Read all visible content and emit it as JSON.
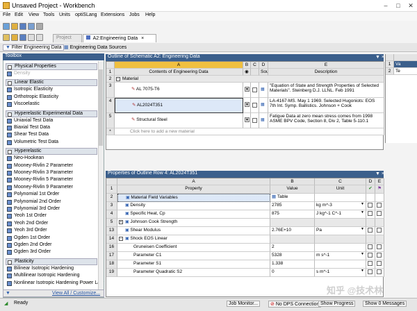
{
  "window": {
    "title": "Unsaved Project - Workbench"
  },
  "menu": [
    "File",
    "Edit",
    "View",
    "Tools",
    "Units",
    "optiSLang",
    "Extensions",
    "Jobs",
    "Help"
  ],
  "tabs": {
    "project": "Project",
    "engineering": "A2:Engineering Data"
  },
  "subtabs": {
    "filter": "Filter Engineering Data",
    "sources": "Engineering Data Sources"
  },
  "toolbox": {
    "title": "Toolbox",
    "groups": [
      {
        "label": "Physical Properties",
        "items": [
          "Density"
        ]
      },
      {
        "label": "Linear Elastic",
        "items": [
          "Isotropic Elasticity",
          "Orthotropic Elasticity",
          "Viscoelastic"
        ]
      },
      {
        "label": "Hyperelastic Experimental Data",
        "items": [
          "Uniaxial Test Data",
          "Biaxial Test Data",
          "Shear Test Data",
          "Volumetric Test Data"
        ]
      },
      {
        "label": "Hyperelastic",
        "items": [
          "Neo-Hookean",
          "Mooney-Rivlin 2 Parameter",
          "Mooney-Rivlin 3 Parameter",
          "Mooney-Rivlin 5 Parameter",
          "Mooney-Rivlin 9 Parameter",
          "Polynomial 1st Order",
          "Polynomial 2nd Order",
          "Polynomial 3rd Order",
          "Yeoh 1st Order",
          "Yeoh 2nd Order",
          "Yeoh 3rd Order",
          "Ogden 1st Order",
          "Ogden 2nd Order",
          "Ogden 3rd Order"
        ]
      },
      {
        "label": "Plasticity",
        "items": [
          "Bilinear Isotropic Hardening",
          "Multilinear Isotropic Hardening",
          "Nonlinear Isotropic Hardening Power Law"
        ]
      }
    ],
    "footer": "View All / Customize..."
  },
  "outline": {
    "title": "Outline of Schematic A2: Engineering Data",
    "cols": [
      "A",
      "B",
      "C",
      "D",
      "E"
    ],
    "head": {
      "a": "Contents of Engineering Data",
      "d": "Source",
      "e": "Description"
    },
    "rows": [
      {
        "n": "1"
      },
      {
        "n": "2",
        "a": "Material"
      },
      {
        "n": "3",
        "a": "AL 7075-T6",
        "e": "\"Equation of State and Strength Properties of Selected Materials\". Steinberg D.J. LLNL. Feb 1991"
      },
      {
        "n": "4",
        "a": "AL2024T351",
        "e": "LA-4167-MS. May 1 1969. Selected Hugoniots: EOS 7th Int. Symp. Ballistics. Johnson + Cook"
      },
      {
        "n": "5",
        "a": "Structural Steel",
        "e": "Fatigue Data at zero mean stress comes from 1998 ASME BPV Code, Section 8, Div 2, Table 5-110.1"
      },
      {
        "n": "*",
        "a": "Click here to add a new material"
      }
    ],
    "right": {
      "r1": "1",
      "r2": "2",
      "t1": "Va",
      "t2": "Te"
    }
  },
  "props": {
    "title": "Properties of Outline Row 4: AL2024T351",
    "cols": [
      "A",
      "B",
      "C",
      "D",
      "E"
    ],
    "head": {
      "a": "Property",
      "b": "Value",
      "c": "Unit"
    },
    "rows": [
      {
        "n": "1"
      },
      {
        "n": "2",
        "a": "Material Field Variables",
        "b": "Table"
      },
      {
        "n": "3",
        "a": "Density",
        "b": "2785",
        "c": "kg m^-3"
      },
      {
        "n": "4",
        "a": "Specific Heat, Cp",
        "b": "875",
        "c": "J kg^-1 C^-1"
      },
      {
        "n": "5",
        "a": "Johnson Cook Strength"
      },
      {
        "n": "13",
        "a": "Shear Modulus",
        "b": "2.76E+10",
        "c": "Pa"
      },
      {
        "n": "14",
        "a": "Shock EOS Linear"
      },
      {
        "n": "16",
        "a": "Gruneisen Coefficient",
        "b": "2"
      },
      {
        "n": "17",
        "a": "Parameter C1",
        "b": "5328",
        "c": "m s^-1"
      },
      {
        "n": "18",
        "a": "Parameter S1",
        "b": "1.338"
      },
      {
        "n": "19",
        "a": "Parameter Quadratic S2",
        "b": "0",
        "c": "s m^-1"
      }
    ]
  },
  "status": {
    "ready": "Ready",
    "job": "Job Monitor...",
    "dps": "No DPS Connection",
    "progress": "Show Progress",
    "messages": "Show 0 Messages"
  },
  "watermark": "知乎 @技术林"
}
